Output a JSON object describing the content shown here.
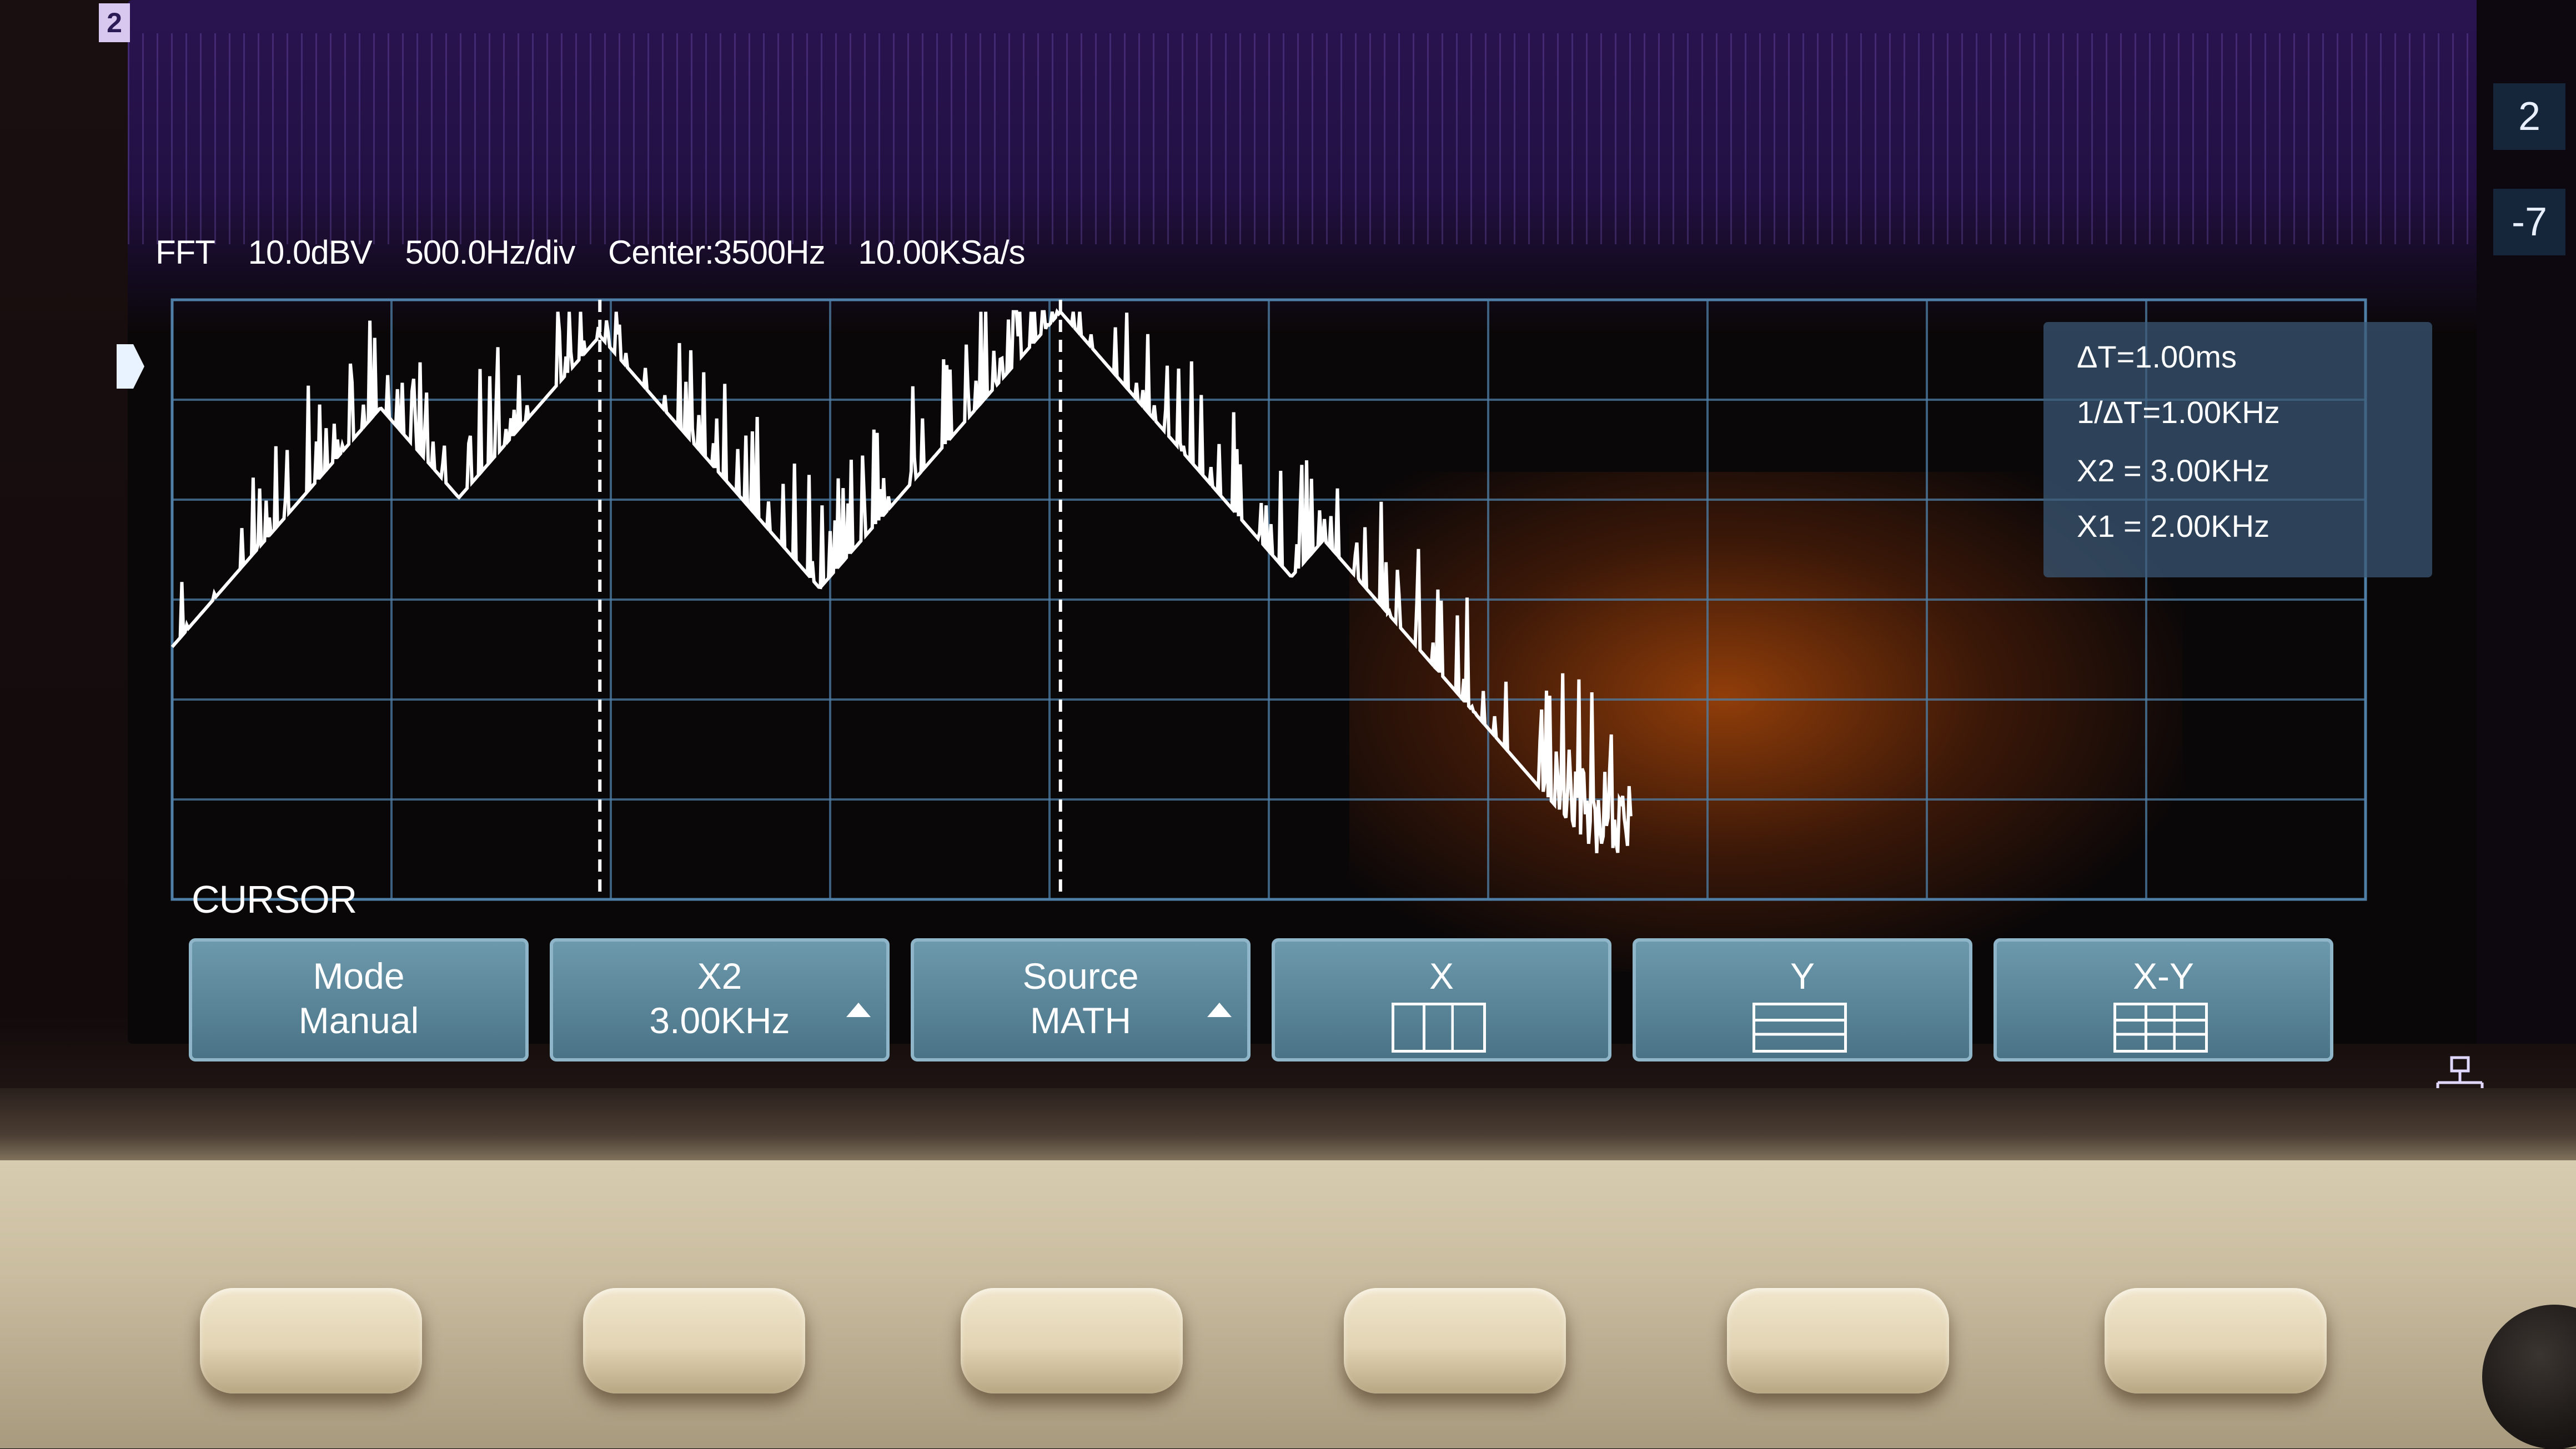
{
  "fft": {
    "label": "FFT",
    "scale": "10.0dBV",
    "span": "500.0Hz/div",
    "center": "Center:3500Hz",
    "sample_rate": "10.00KSa/s"
  },
  "cursor_readout": {
    "delta_t": "ΔT=1.00ms",
    "inv_delta_t": "1/ΔT=1.00KHz",
    "x2": "X2 = 3.00KHz",
    "x1": "X1 = 2.00KHz"
  },
  "menu": {
    "title": "CURSOR",
    "softkeys": [
      {
        "line1": "Mode",
        "line2": "Manual"
      },
      {
        "line1": "X2",
        "line2": "3.00KHz"
      },
      {
        "line1": "Source",
        "line2": "MATH"
      },
      {
        "line1": "X",
        "line2": ""
      },
      {
        "line1": "Y",
        "line2": ""
      },
      {
        "line1": "X-Y",
        "line2": ""
      }
    ]
  },
  "right_rail": {
    "item1": "2",
    "item2": "-7"
  },
  "channel_badge": "2",
  "colors": {
    "trace": "#ffffff",
    "grid": "#4f7fa6",
    "softkey": "#5c8aa0",
    "readout_bg": "#3c5a78"
  },
  "icons": [
    "up-arrow-icon",
    "x-cursor-icon",
    "y-cursor-icon",
    "xy-cursor-icon",
    "network-icon",
    "trigger-marker-icon"
  ]
}
